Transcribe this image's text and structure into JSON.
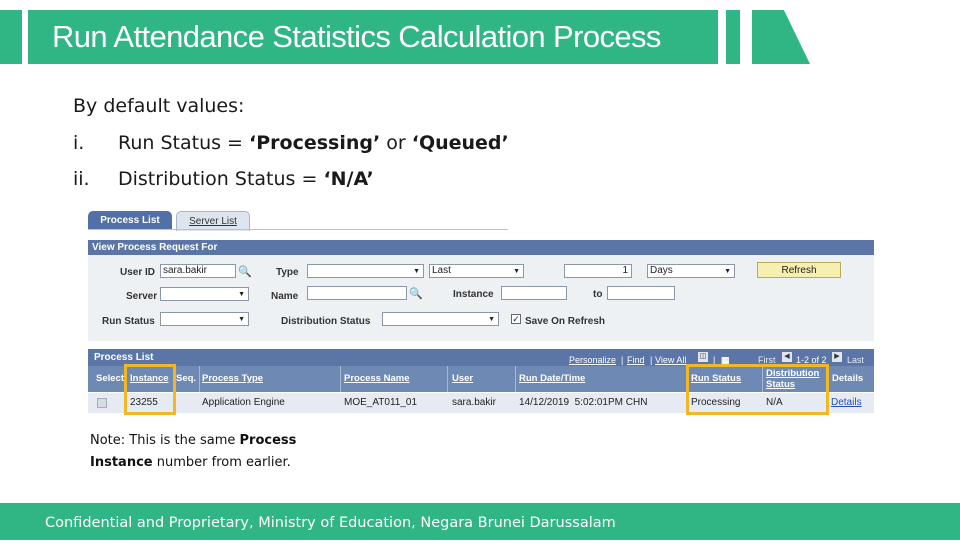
{
  "slide": {
    "title": "Run Attendance Statistics Calculation Process",
    "intro": {
      "heading": "By default values:",
      "items": [
        {
          "num": "i.",
          "text_prefix": "Run Status = ",
          "text_value": "‘Processing’",
          "text_mid": " or ",
          "text_value2": "‘Queued’"
        },
        {
          "num": "ii.",
          "text_prefix": "Distribution Status = ",
          "text_value": "‘N/A’"
        }
      ]
    },
    "note": {
      "line1_prefix": "Note: This is the same ",
      "line1_bold": "Process",
      "line2_bold": "Instance",
      "line2_suffix": " number from earlier."
    },
    "footer": "Confidential and Proprietary, Ministry of Education, Negara Brunei Darussalam",
    "highlight_color": "#f2b824",
    "accent_color": "#2fb684"
  },
  "ps": {
    "tabs": [
      "Process List",
      "Server List"
    ],
    "filter": {
      "header": "View Process Request For",
      "user_id_label": "User ID",
      "user_id_value": "sara.bakir",
      "type_label": "Type",
      "type_value": "",
      "last_value": "Last",
      "count_value": "1",
      "days_value": "Days",
      "refresh_label": "Refresh",
      "server_label": "Server",
      "server_value": "",
      "name_label": "Name",
      "name_value": "",
      "instance_label": "Instance",
      "instance_from": "",
      "to_label": "to",
      "instance_to": "",
      "run_status_label": "Run Status",
      "run_status_value": "",
      "dist_status_label": "Distribution Status",
      "dist_status_value": "",
      "save_on_refresh_label": "Save On Refresh",
      "save_on_refresh_checked": true
    },
    "process_list": {
      "header": "Process List",
      "links": {
        "personalize": "Personalize",
        "find": "Find",
        "view_all": "View All"
      },
      "nav": {
        "first": "First",
        "range": "1-2 of 2",
        "last": "Last"
      },
      "columns": [
        "Select",
        "Instance",
        "Seq.",
        "Process Type",
        "Process Name",
        "User",
        "Run Date/Time",
        "Run Status",
        "Distribution Status",
        "Details"
      ],
      "rows": [
        {
          "select": false,
          "instance": "23255",
          "seq": "",
          "process_type": "Application Engine",
          "process_name": "MOE_AT011_01",
          "user": "sara.bakir",
          "run_datetime": "14/12/2019  5:02:01PM CHN",
          "run_status": "Processing",
          "distribution_status": "N/A",
          "details": "Details"
        }
      ]
    }
  }
}
